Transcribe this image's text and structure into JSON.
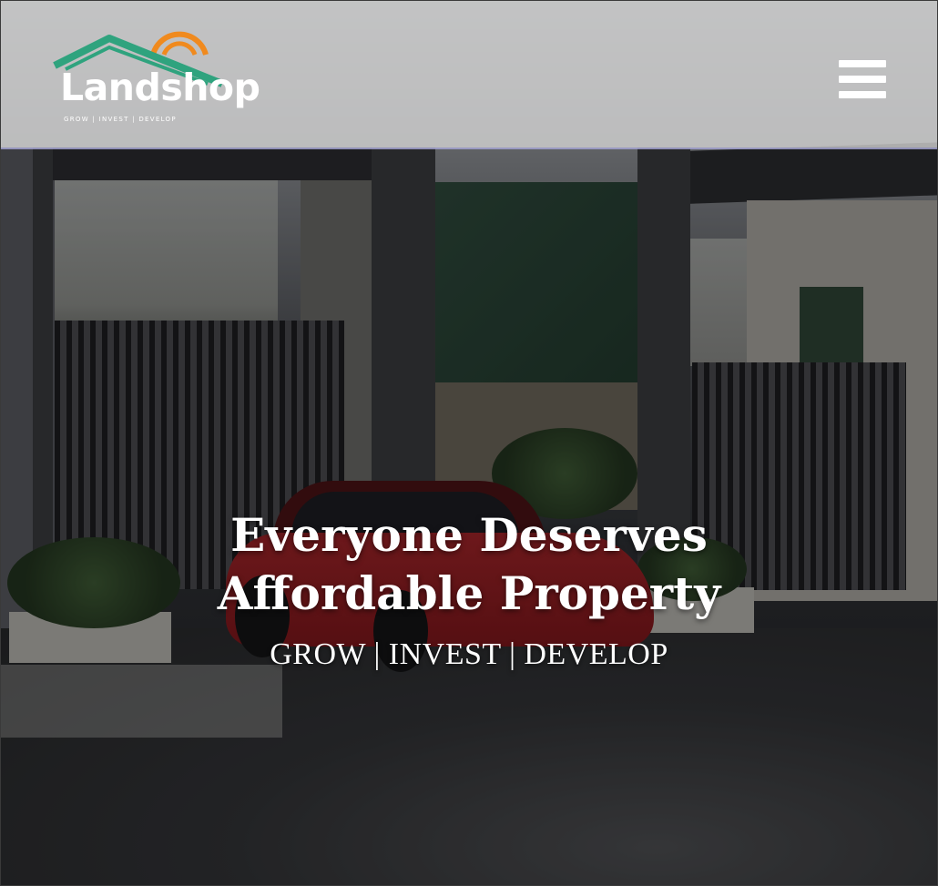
{
  "header": {
    "logo": {
      "name": "Landshop",
      "tagline": "GROW | INVEST | DEVELOP",
      "colors": {
        "roof": "#2fa37e",
        "sun": "#f08a1e",
        "text": "#ffffff"
      }
    },
    "menu_icon": "hamburger-menu-icon"
  },
  "hero": {
    "headline": "Everyone Deserves Affordable Property",
    "tagline": "GROW | INVEST | DEVELOP"
  },
  "colors": {
    "header_bg": "#d6d6d6",
    "text": "#ffffff"
  }
}
